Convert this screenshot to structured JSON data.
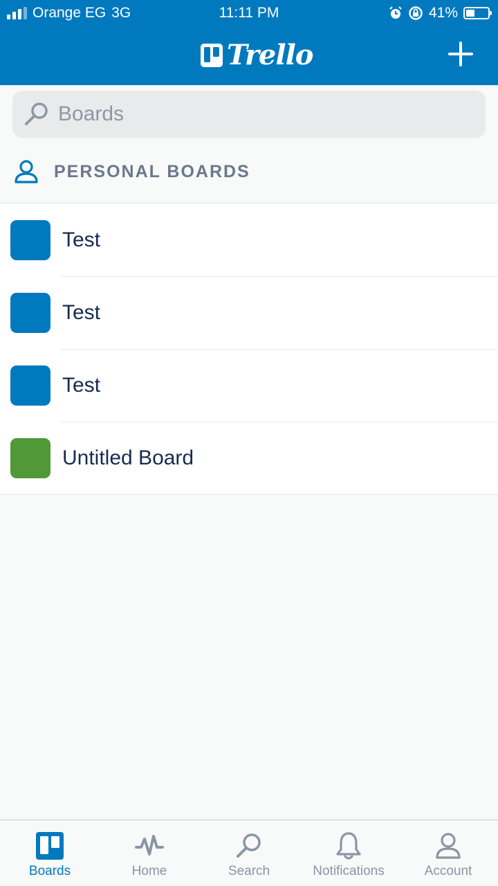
{
  "status_bar": {
    "carrier": "Orange EG",
    "network": "3G",
    "time": "11:11 PM",
    "battery_percent": "41%",
    "battery_level": 0.41,
    "signal_bars_active": 3
  },
  "header": {
    "app_name": "Trello",
    "add_icon": "plus-icon"
  },
  "search": {
    "placeholder": "Boards",
    "value": ""
  },
  "section": {
    "title": "PERSONAL BOARDS"
  },
  "boards": [
    {
      "name": "Test",
      "color": "#0079bf"
    },
    {
      "name": "Test",
      "color": "#0079bf"
    },
    {
      "name": "Test",
      "color": "#0079bf"
    },
    {
      "name": "Untitled Board",
      "color": "#519839"
    }
  ],
  "tabs": [
    {
      "label": "Boards",
      "icon": "boards-icon",
      "active": true
    },
    {
      "label": "Home",
      "icon": "activity-icon",
      "active": false
    },
    {
      "label": "Search",
      "icon": "search-icon",
      "active": false
    },
    {
      "label": "Notifications",
      "icon": "bell-icon",
      "active": false
    },
    {
      "label": "Account",
      "icon": "person-icon",
      "active": false
    }
  ],
  "colors": {
    "brand": "#0079bf",
    "tab_inactive": "#8b95a4"
  }
}
